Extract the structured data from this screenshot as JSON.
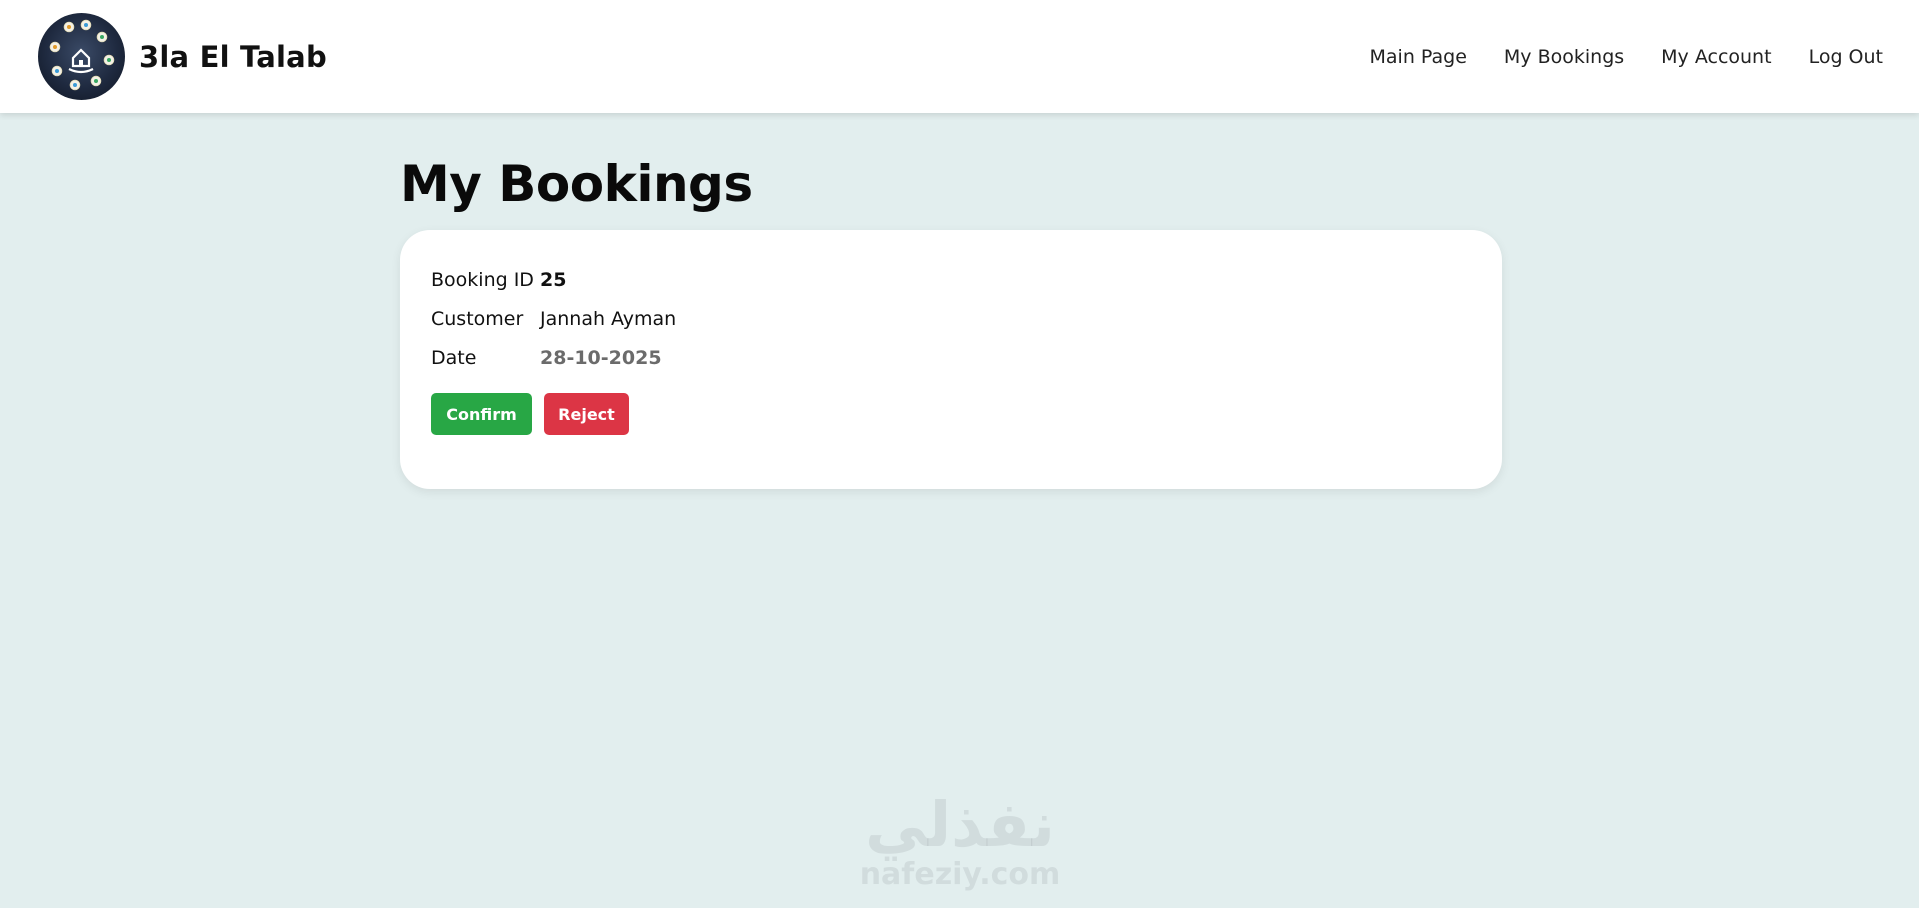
{
  "brand": {
    "name": "3la El Talab",
    "logo_icon": "services-circle-logo"
  },
  "nav": {
    "items": [
      "Main Page",
      "My Bookings",
      "My Account",
      "Log Out"
    ]
  },
  "page": {
    "title": "My Bookings"
  },
  "booking": {
    "id_label": "Booking ID",
    "id_value": "25",
    "customer_label": "Customer",
    "customer_value": "Jannah Ayman",
    "date_label": "Date",
    "date_value": "28-10-2025",
    "confirm_label": "Confirm",
    "reject_label": "Reject"
  },
  "watermark": {
    "arabic": "نفذلي",
    "latin": "nafeziy.com"
  },
  "colors": {
    "background": "#e2eeee",
    "confirm": "#28a745",
    "reject": "#dc3545",
    "date_text": "#6b6b6b"
  }
}
